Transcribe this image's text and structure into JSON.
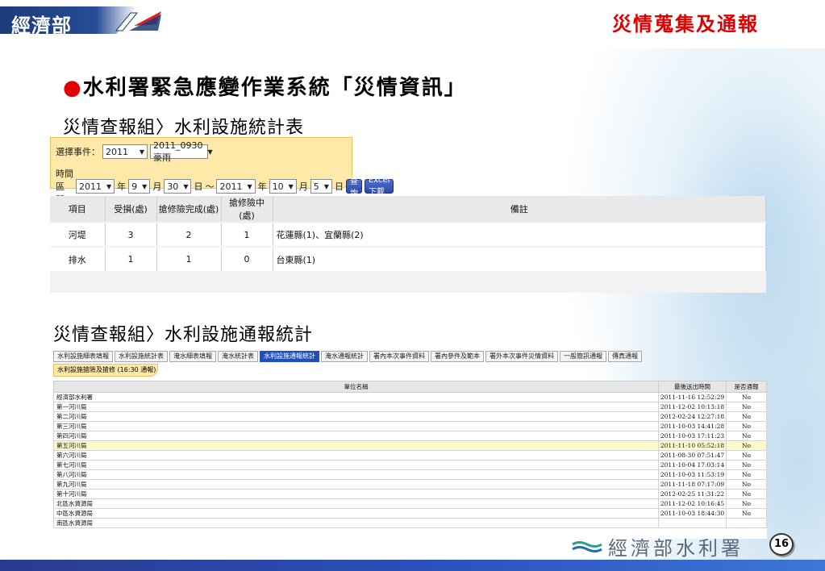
{
  "header": {
    "logo_text": "經濟部",
    "slide_title": "災情蒐集及通報"
  },
  "bullet_title": "水利署緊急應變作業系統「災情資訊」",
  "section1_title": "災情查報組〉水利設施統計表",
  "query": {
    "event_label": "選擇事件：",
    "event_year": "2011",
    "event_name": "2011_0930豪雨",
    "range_label": "時間區間：",
    "from_year": "2011",
    "year_unit": "年",
    "from_month": "9",
    "month_unit": "月",
    "from_day": "30",
    "day_unit": "日",
    "tilde": "～",
    "to_year": "2011",
    "to_month": "10",
    "to_day": "5",
    "query_button": "查詢",
    "excel_button": "Excel下載"
  },
  "table1": {
    "headers": [
      "項目",
      "受損(處)",
      "搶修險完成(處)",
      "搶修險中(處)",
      "備註"
    ],
    "rows": [
      [
        "河堤",
        "3",
        "2",
        "1",
        "花蓮縣(1)、宜蘭縣(2)"
      ],
      [
        "排水",
        "1",
        "1",
        "0",
        "台東縣(1)"
      ]
    ]
  },
  "section2_title": "災情查報組〉水利設施通報統計",
  "tabs": [
    "水利設施細表填報",
    "水利設施統計表",
    "淹水細表填報",
    "淹水統計表",
    "水利設施通報統計",
    "淹水通報統計",
    "署內本次事件資料",
    "署內參件及範本",
    "署外本次事件災情資料",
    "一般簡訊通報",
    "傳真通報"
  ],
  "active_tab": "水利設施通報統計",
  "subpanel_label": "水利設施搶險及搶修 (16:30 通報)",
  "table2": {
    "headers": [
      "單位名稱",
      "最後送出時間",
      "是否通報"
    ],
    "rows": [
      [
        "經濟部水利署",
        "2011-11-16 12:52:29",
        "No"
      ],
      [
        "第一河川局",
        "2011-12-02 10:13:18",
        "No"
      ],
      [
        "第二河川局",
        "2012-02-24 12:27:18",
        "No"
      ],
      [
        "第三河川局",
        "2011-10-03 14:41:28",
        "No"
      ],
      [
        "第四河川局",
        "2011-10-03 17:11:23",
        "No"
      ],
      [
        "第五河川局",
        "2011-11-10 05:52:18",
        "No"
      ],
      [
        "第六河川局",
        "2011-08-30 07:51:47",
        "No"
      ],
      [
        "第七河川局",
        "2011-10-04 17:03:14",
        "No"
      ],
      [
        "第八河川局",
        "2011-10-03 11:53:19",
        "No"
      ],
      [
        "第九河川局",
        "2011-11-18 07:17:09",
        "No"
      ],
      [
        "第十河川局",
        "2012-02-25 11:31:22",
        "No"
      ],
      [
        "北區水資源局",
        "2011-12-02 10:16:45",
        "No"
      ],
      [
        "中區水資源局",
        "2011-10-03 18:44:30",
        "No"
      ],
      [
        "南區水資源局",
        "",
        ""
      ]
    ],
    "highlight_index": 5
  },
  "footer": {
    "org_text": "經濟部水利署",
    "page_number": "16"
  },
  "colors": {
    "title_red": "#e10000",
    "panel_yellow": "#ffe9a8",
    "tab_active": "#1f4fbf",
    "brand_blue": "#1b3c7a"
  }
}
